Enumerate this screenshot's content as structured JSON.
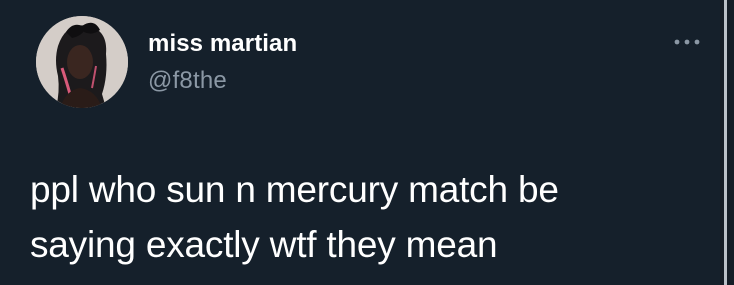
{
  "tweet": {
    "author": {
      "display_name": "miss martian",
      "handle": "@f8the",
      "avatar_icon": "profile-photo-avatar"
    },
    "more_icon": "more-horizontal-icon",
    "text_lines": [
      "ppl who sun n mercury match be",
      "saying exactly wtf they mean"
    ]
  },
  "colors": {
    "background": "#15202b",
    "text_primary": "#ffffff",
    "text_secondary": "#8b98a5"
  }
}
